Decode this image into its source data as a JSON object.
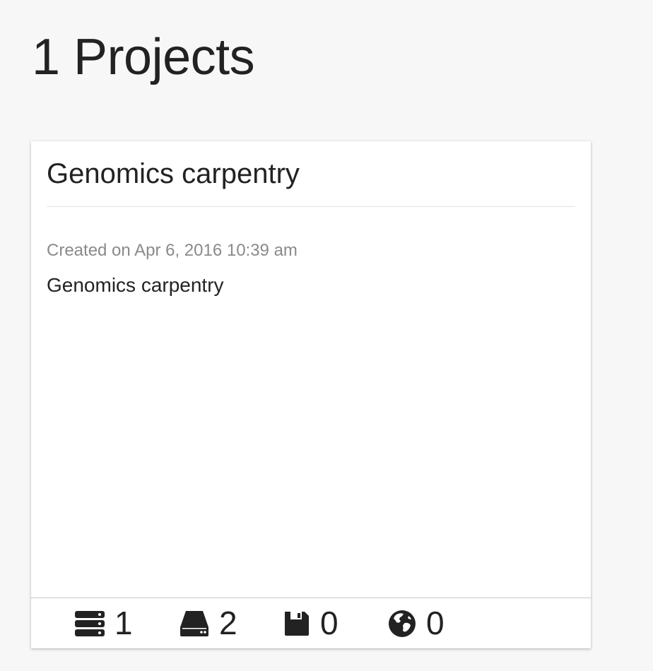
{
  "page": {
    "title": "1 Projects"
  },
  "project_card": {
    "title": "Genomics carpentry",
    "created": "Created on Apr 6, 2016 10:39 am",
    "description": "Genomics carpentry",
    "stats": {
      "instances": {
        "icon": "server-stack-icon",
        "count": "1"
      },
      "volumes": {
        "icon": "hard-drive-icon",
        "count": "2"
      },
      "images": {
        "icon": "floppy-disk-icon",
        "count": "0"
      },
      "links": {
        "icon": "globe-icon",
        "count": "0"
      }
    }
  }
}
